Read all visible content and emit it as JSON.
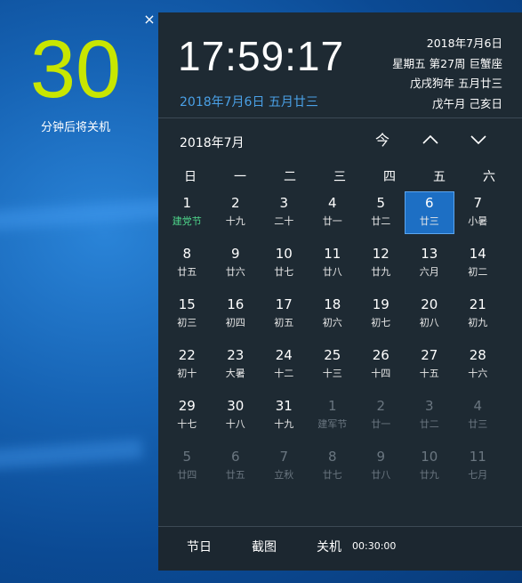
{
  "countdown": {
    "value": "30",
    "label": "分钟后将关机",
    "close": "×"
  },
  "header": {
    "time": "17:59:17",
    "subdate": "2018年7月6日 五月廿三",
    "info": [
      "2018年7月6日",
      "星期五 第27周 巨蟹座",
      "戊戌狗年 五月廿三",
      "戊午月 己亥日"
    ]
  },
  "month": {
    "title": "2018年7月",
    "today_btn": "今",
    "prev": "∧",
    "next": "∨"
  },
  "weekdays": [
    "日",
    "一",
    "二",
    "三",
    "四",
    "五",
    "六"
  ],
  "weeks": [
    [
      {
        "d": "1",
        "l": "建党节",
        "fest": true
      },
      {
        "d": "2",
        "l": "十九"
      },
      {
        "d": "3",
        "l": "二十"
      },
      {
        "d": "4",
        "l": "廿一"
      },
      {
        "d": "5",
        "l": "廿二"
      },
      {
        "d": "6",
        "l": "廿三",
        "today": true
      },
      {
        "d": "7",
        "l": "小暑"
      }
    ],
    [
      {
        "d": "8",
        "l": "廿五"
      },
      {
        "d": "9",
        "l": "廿六"
      },
      {
        "d": "10",
        "l": "廿七"
      },
      {
        "d": "11",
        "l": "廿八"
      },
      {
        "d": "12",
        "l": "廿九"
      },
      {
        "d": "13",
        "l": "六月"
      },
      {
        "d": "14",
        "l": "初二"
      }
    ],
    [
      {
        "d": "15",
        "l": "初三"
      },
      {
        "d": "16",
        "l": "初四"
      },
      {
        "d": "17",
        "l": "初五"
      },
      {
        "d": "18",
        "l": "初六"
      },
      {
        "d": "19",
        "l": "初七"
      },
      {
        "d": "20",
        "l": "初八"
      },
      {
        "d": "21",
        "l": "初九"
      }
    ],
    [
      {
        "d": "22",
        "l": "初十"
      },
      {
        "d": "23",
        "l": "大暑"
      },
      {
        "d": "24",
        "l": "十二"
      },
      {
        "d": "25",
        "l": "十三"
      },
      {
        "d": "26",
        "l": "十四"
      },
      {
        "d": "27",
        "l": "十五"
      },
      {
        "d": "28",
        "l": "十六"
      }
    ],
    [
      {
        "d": "29",
        "l": "十七"
      },
      {
        "d": "30",
        "l": "十八"
      },
      {
        "d": "31",
        "l": "十九"
      },
      {
        "d": "1",
        "l": "建军节",
        "dim": true
      },
      {
        "d": "2",
        "l": "廿一",
        "dim": true
      },
      {
        "d": "3",
        "l": "廿二",
        "dim": true
      },
      {
        "d": "4",
        "l": "廿三",
        "dim": true
      }
    ],
    [
      {
        "d": "5",
        "l": "廿四",
        "dim": true
      },
      {
        "d": "6",
        "l": "廿五",
        "dim": true
      },
      {
        "d": "7",
        "l": "立秋",
        "dim": true
      },
      {
        "d": "8",
        "l": "廿七",
        "dim": true
      },
      {
        "d": "9",
        "l": "廿八",
        "dim": true
      },
      {
        "d": "10",
        "l": "廿九",
        "dim": true
      },
      {
        "d": "11",
        "l": "七月",
        "dim": true
      }
    ]
  ],
  "footer": {
    "holiday": "节日",
    "screenshot": "截图",
    "shutdown": "关机",
    "timer": "00:30:00"
  },
  "colors": {
    "countdown": "#c8e600",
    "today_bg": "#1d6fc4",
    "festival": "#4ed48a",
    "panel_bg": "#1e2a33",
    "accent_date": "#4aa0e6"
  }
}
